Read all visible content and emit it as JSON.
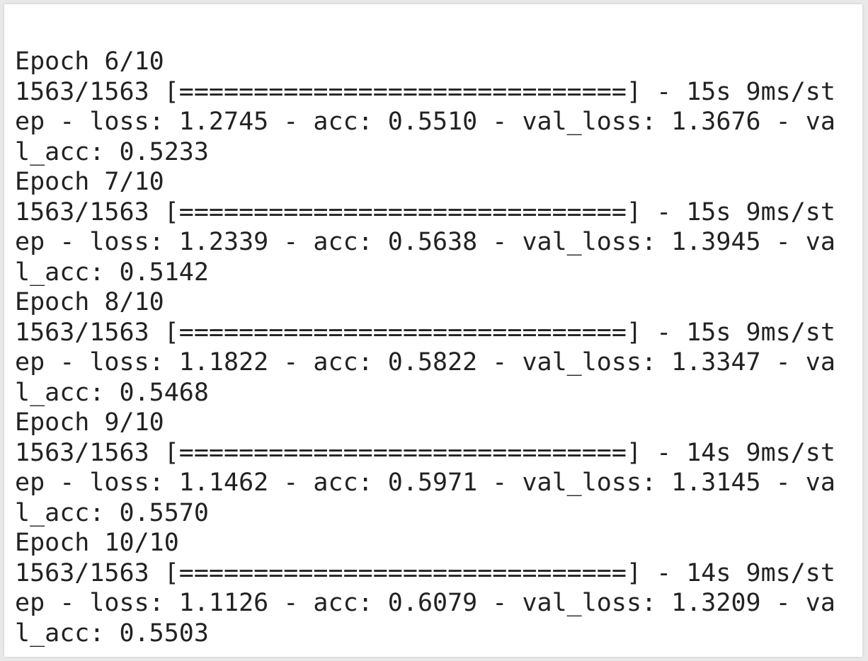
{
  "output": {
    "lines": [
      "Epoch 6/10",
      "1563/1563 [==============================] - 15s 9ms/st",
      "ep - loss: 1.2745 - acc: 0.5510 - val_loss: 1.3676 - va",
      "l_acc: 0.5233",
      "Epoch 7/10",
      "1563/1563 [==============================] - 15s 9ms/st",
      "ep - loss: 1.2339 - acc: 0.5638 - val_loss: 1.3945 - va",
      "l_acc: 0.5142",
      "Epoch 8/10",
      "1563/1563 [==============================] - 15s 9ms/st",
      "ep - loss: 1.1822 - acc: 0.5822 - val_loss: 1.3347 - va",
      "l_acc: 0.5468",
      "Epoch 9/10",
      "1563/1563 [==============================] - 14s 9ms/st",
      "ep - loss: 1.1462 - acc: 0.5971 - val_loss: 1.3145 - va",
      "l_acc: 0.5570",
      "Epoch 10/10",
      "1563/1563 [==============================] - 14s 9ms/st",
      "ep - loss: 1.1126 - acc: 0.6079 - val_loss: 1.3209 - va",
      "l_acc: 0.5503"
    ]
  }
}
